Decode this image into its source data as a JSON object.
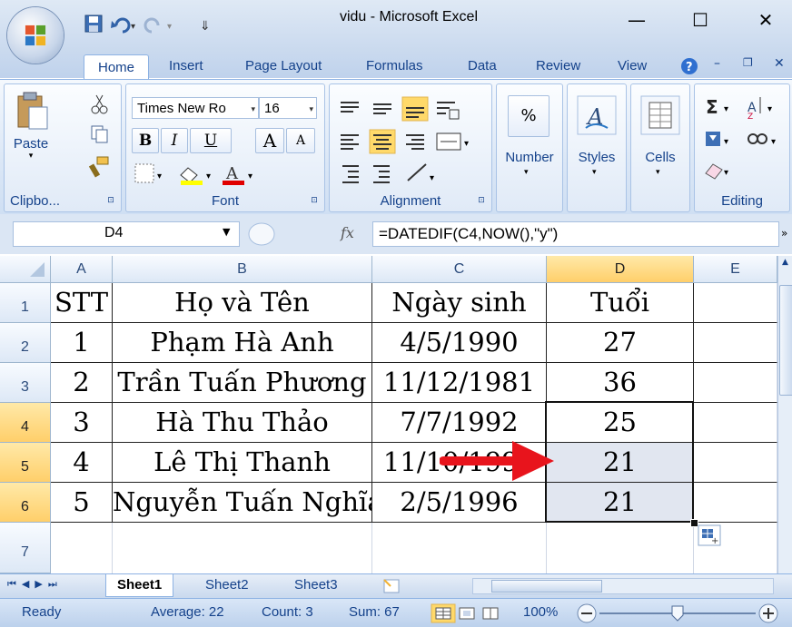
{
  "window": {
    "title": "vidu - Microsoft Excel",
    "minimize": "—",
    "maximize": "☐",
    "close": "✕"
  },
  "qat": {
    "save": "💾",
    "undo": "↶",
    "redo": "↷",
    "more": "▾"
  },
  "tabs": [
    "Home",
    "Insert",
    "Page Layout",
    "Formulas",
    "Data",
    "Review",
    "View"
  ],
  "ribbon": {
    "clipboard": {
      "paste": "Paste",
      "label": "Clipbo...",
      "launcher": "⊡"
    },
    "font": {
      "name": "Times New Ro",
      "size": "16",
      "bold": "B",
      "italic": "I",
      "underline": "U",
      "grow": "A",
      "shrink": "A",
      "label": "Font",
      "launcher": "⊡"
    },
    "alignment": {
      "label": "Alignment",
      "launcher": "⊡"
    },
    "number": {
      "label": "Number",
      "symbol": "%"
    },
    "styles": {
      "label": "Styles"
    },
    "cells": {
      "label": "Cells"
    },
    "editing": {
      "label": "Editing",
      "sum": "Σ"
    }
  },
  "formula_bar": {
    "name_box": "D4",
    "fx": "fx",
    "formula": "=DATEDIF(C4,NOW(),\"y\")"
  },
  "grid": {
    "columns": [
      "A",
      "B",
      "C",
      "D",
      "E"
    ],
    "rows": [
      {
        "num": "1",
        "cells": [
          "STT",
          "Họ và Tên",
          "Ngày sinh",
          "Tuổi",
          ""
        ]
      },
      {
        "num": "2",
        "cells": [
          "1",
          "Phạm Hà Anh",
          "4/5/1990",
          "27",
          ""
        ]
      },
      {
        "num": "3",
        "cells": [
          "2",
          "Trần Tuấn Phương",
          "11/12/1981",
          "36",
          ""
        ]
      },
      {
        "num": "4",
        "cells": [
          "3",
          "Hà Thu Thảo",
          "7/7/1992",
          "25",
          ""
        ]
      },
      {
        "num": "5",
        "cells": [
          "4",
          "Lê Thị Thanh",
          "11/10/1995",
          "21",
          ""
        ]
      },
      {
        "num": "6",
        "cells": [
          "5",
          "Nguyễn Tuấn Nghĩa",
          "2/5/1996",
          "21",
          ""
        ]
      },
      {
        "num": "7",
        "cells": [
          "",
          "",
          "",
          "",
          ""
        ]
      }
    ],
    "selected_column": "D",
    "selected_rows": [
      "4",
      "5",
      "6"
    ]
  },
  "sheets": [
    "Sheet1",
    "Sheet2",
    "Sheet3"
  ],
  "active_sheet": "Sheet1",
  "status": {
    "ready": "Ready",
    "average": "Average: 22",
    "count": "Count: 3",
    "sum": "Sum: 67",
    "zoom": "100%"
  },
  "colors": {
    "selection_header": "#ffd36e",
    "selection_fill": "#e1e6f0",
    "arrow": "#e8141c",
    "ribbon_text": "#15428b"
  }
}
